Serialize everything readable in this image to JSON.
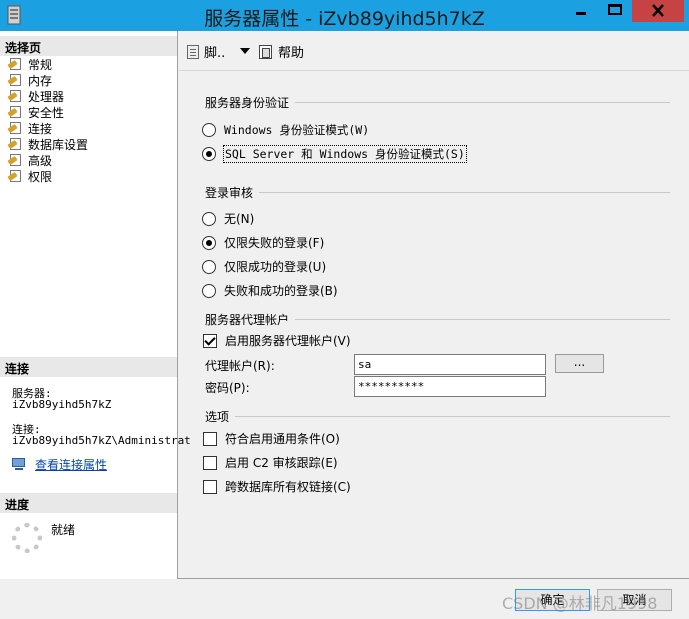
{
  "window": {
    "title": "服务器属性 - iZvb89yihd5h7kZ",
    "accent_color": "#1ba1e2",
    "close_color": "#c74343"
  },
  "left_panel": {
    "select_page_header": "选择页",
    "pages": [
      "常规",
      "内存",
      "处理器",
      "安全性",
      "连接",
      "数据库设置",
      "高级",
      "权限"
    ],
    "connection_header": "连接",
    "server_label": "服务器:",
    "server_value": "iZvb89yihd5h7kZ",
    "connection_label": "连接:",
    "connection_value": "iZvb89yihd5h7kZ\\Administrat",
    "view_connection_properties": "查看连接属性",
    "progress_header": "进度",
    "progress_status": "就绪"
  },
  "toolbar": {
    "script_label": "脚..",
    "help_label": "帮助"
  },
  "server_authentication": {
    "title": "服务器身份验证",
    "options": [
      "Windows 身份验证模式(W)",
      "SQL Server 和 Windows 身份验证模式(S)"
    ],
    "selected_index": 1
  },
  "login_auditing": {
    "title": "登录审核",
    "options": [
      "无(N)",
      "仅限失败的登录(F)",
      "仅限成功的登录(U)",
      "失败和成功的登录(B)"
    ],
    "selected_index": 1
  },
  "proxy_account": {
    "title": "服务器代理帐户",
    "enable_label": "启用服务器代理帐户(V)",
    "enabled": true,
    "proxy_label": "代理帐户(R):",
    "proxy_value": "sa",
    "browse_label": "...",
    "password_label": "密码(P):",
    "password_value": "**********"
  },
  "options": {
    "title": "选项",
    "items": [
      {
        "label": "符合启用通用条件(O)",
        "checked": false
      },
      {
        "label": "启用 C2 审核跟踪(E)",
        "checked": false
      },
      {
        "label": "跨数据库所有权链接(C)",
        "checked": false
      }
    ]
  },
  "buttons": {
    "ok": "确定",
    "cancel": "取消"
  },
  "watermark": "CSDN @林非凡1998"
}
